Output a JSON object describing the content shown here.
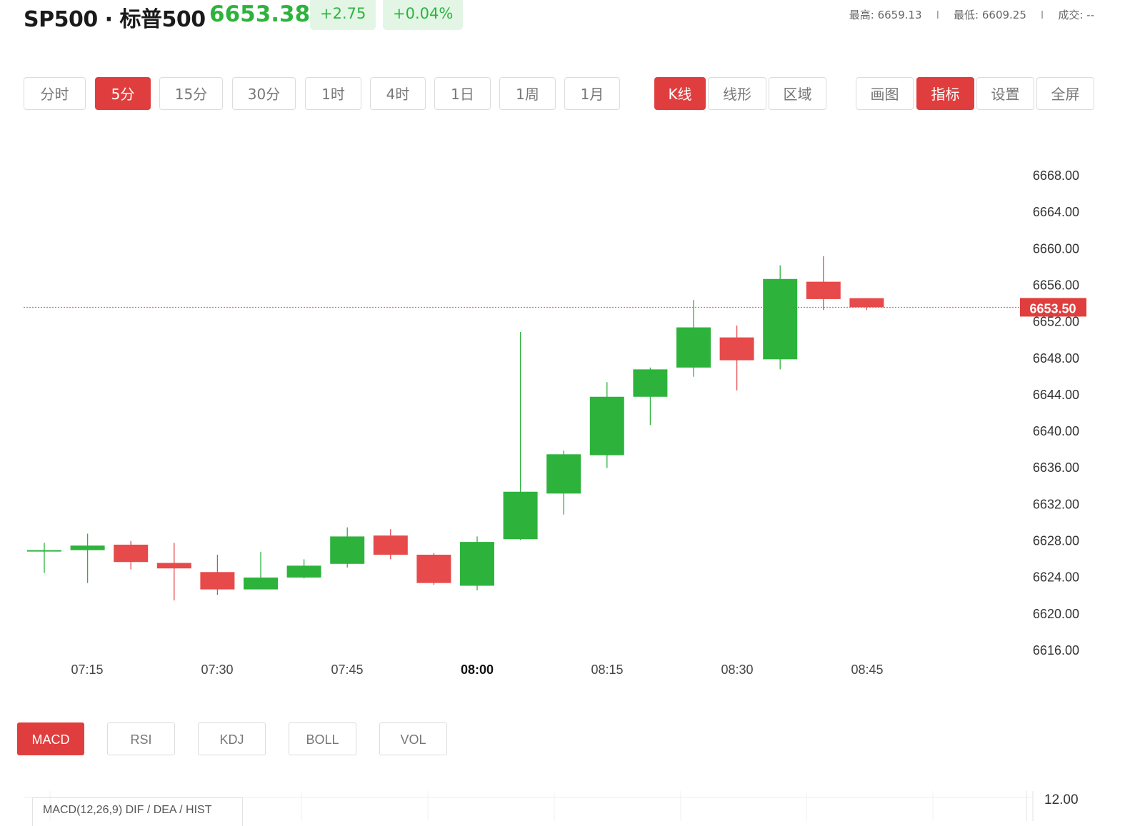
{
  "header": {
    "symbol": "SP500 · 标普500",
    "price": "6653.38",
    "change": "+2.75",
    "change_pct": "+0.04%",
    "high": "最高: 6659.13",
    "low": "最低: 6609.25",
    "volume": "成交: --",
    "separator": "I"
  },
  "period_tabs": [
    {
      "label": "分时",
      "active": false
    },
    {
      "label": "5分",
      "active": true
    },
    {
      "label": "15分",
      "active": false
    },
    {
      "label": "30分",
      "active": false
    },
    {
      "label": "1时",
      "active": false
    },
    {
      "label": "4时",
      "active": false
    },
    {
      "label": "1日",
      "active": false
    },
    {
      "label": "1周",
      "active": false
    },
    {
      "label": "1月",
      "active": false
    }
  ],
  "chart_type_tabs": [
    {
      "label": "K线",
      "active": true
    },
    {
      "label": "线形",
      "active": false
    },
    {
      "label": "区域",
      "active": false
    }
  ],
  "tool_tabs": [
    {
      "label": "画图",
      "active": false
    },
    {
      "label": "指标",
      "active": true
    },
    {
      "label": "设置",
      "active": false
    },
    {
      "label": "全屏",
      "active": false
    }
  ],
  "indicator_tabs": [
    {
      "label": "MACD",
      "active": true
    },
    {
      "label": "RSI",
      "active": false
    },
    {
      "label": "KDJ",
      "active": false
    },
    {
      "label": "BOLL",
      "active": false
    },
    {
      "label": "VOL",
      "active": false
    }
  ],
  "macd_label": "MACD(12,26,9) DIF / DEA / HIST",
  "macd_axis_value": "12.00",
  "colors": {
    "up": "#2db33c",
    "down": "#e64a4a",
    "accent": "#e03e3e"
  },
  "chart_data": {
    "type": "candlestick",
    "interval": "5分",
    "x_ticks": [
      "07:15",
      "07:30",
      "07:45",
      "08:00",
      "08:15",
      "08:30",
      "08:45"
    ],
    "y_ticks": [
      "6668.00",
      "6664.00",
      "6660.00",
      "6656.00",
      "6652.00",
      "6648.00",
      "6644.00",
      "6640.00",
      "6636.00",
      "6632.00",
      "6628.00",
      "6624.00",
      "6620.00",
      "6616.00"
    ],
    "ylim": [
      6616,
      6668
    ],
    "last_price": 6653.5,
    "last_price_label": "6653.50",
    "grid": false,
    "candles": [
      {
        "time": "07:10",
        "open": 6626.9,
        "close": 6626.9,
        "high": 6627.7,
        "low": 6624.4
      },
      {
        "time": "07:15",
        "open": 6626.9,
        "close": 6627.4,
        "high": 6628.7,
        "low": 6623.3
      },
      {
        "time": "07:20",
        "open": 6627.5,
        "close": 6625.6,
        "high": 6627.9,
        "low": 6624.8
      },
      {
        "time": "07:25",
        "open": 6625.5,
        "close": 6624.9,
        "high": 6627.7,
        "low": 6621.4
      },
      {
        "time": "07:30",
        "open": 6624.5,
        "close": 6622.6,
        "high": 6626.4,
        "low": 6622.0
      },
      {
        "time": "07:35",
        "open": 6622.6,
        "close": 6623.9,
        "high": 6626.7,
        "low": 6622.6
      },
      {
        "time": "07:40",
        "open": 6623.9,
        "close": 6625.2,
        "high": 6625.9,
        "low": 6623.8
      },
      {
        "time": "07:45",
        "open": 6625.4,
        "close": 6628.4,
        "high": 6629.4,
        "low": 6625.0
      },
      {
        "time": "07:50",
        "open": 6628.5,
        "close": 6626.4,
        "high": 6629.2,
        "low": 6625.9
      },
      {
        "time": "07:55",
        "open": 6626.4,
        "close": 6623.3,
        "high": 6626.6,
        "low": 6623.1
      },
      {
        "time": "08:00",
        "open": 6623.0,
        "close": 6627.8,
        "high": 6628.4,
        "low": 6622.5
      },
      {
        "time": "08:05",
        "open": 6628.1,
        "close": 6633.3,
        "high": 6650.8,
        "low": 6628.0
      },
      {
        "time": "08:10",
        "open": 6633.1,
        "close": 6637.4,
        "high": 6637.8,
        "low": 6630.8
      },
      {
        "time": "08:15",
        "open": 6637.3,
        "close": 6643.7,
        "high": 6645.3,
        "low": 6635.9
      },
      {
        "time": "08:20",
        "open": 6643.7,
        "close": 6646.7,
        "high": 6646.9,
        "low": 6640.6
      },
      {
        "time": "08:25",
        "open": 6646.9,
        "close": 6651.3,
        "high": 6654.3,
        "low": 6645.9
      },
      {
        "time": "08:30",
        "open": 6650.2,
        "close": 6647.7,
        "high": 6651.5,
        "low": 6644.4
      },
      {
        "time": "08:35",
        "open": 6647.8,
        "close": 6656.6,
        "high": 6658.1,
        "low": 6646.7
      },
      {
        "time": "08:40",
        "open": 6656.3,
        "close": 6654.4,
        "high": 6659.1,
        "low": 6653.2
      },
      {
        "time": "08:45",
        "open": 6654.5,
        "close": 6653.5,
        "high": 6654.5,
        "low": 6653.2
      }
    ]
  }
}
